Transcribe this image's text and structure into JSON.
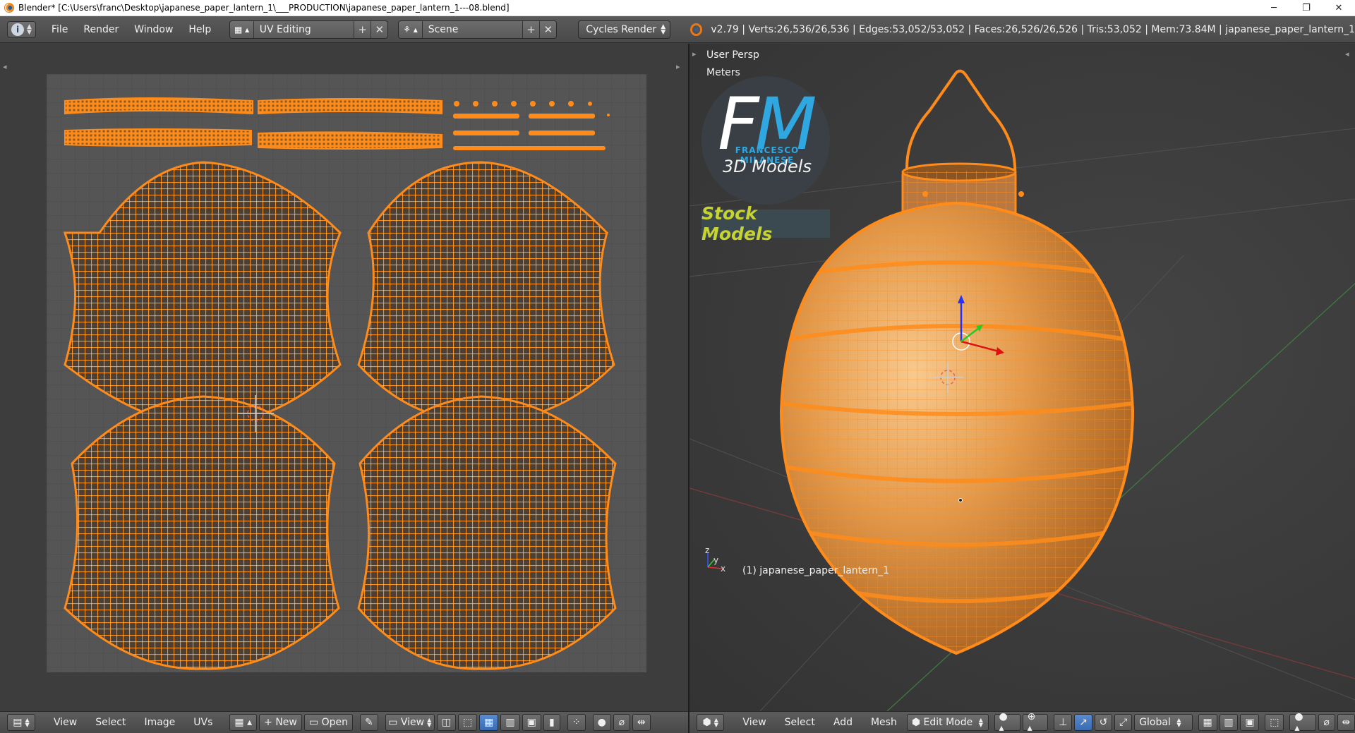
{
  "window": {
    "title": "Blender* [C:\\Users\\franc\\Desktop\\japanese_paper_lantern_1\\___PRODUCTION\\japanese_paper_lantern_1---08.blend]",
    "minimize": "─",
    "restore": "❐",
    "close": "✕"
  },
  "top_header": {
    "info_icon": "i",
    "menus": [
      "File",
      "Render",
      "Window",
      "Help"
    ],
    "screen_layout": "UV Editing",
    "scene": "Scene",
    "render_engine": "Cycles Render",
    "stats": "v2.79 | Verts:26,536/26,536 | Edges:53,052/53,052 | Faces:26,526/26,526 | Tris:53,052 | Mem:73.84M | japanese_paper_lantern_1"
  },
  "viewport": {
    "view_name": "User Persp",
    "units": "Meters",
    "object_label": "(1) japanese_paper_lantern_1",
    "axis_y": "y",
    "axis_x": "x",
    "axis_z": "z"
  },
  "logo": {
    "letter_f": "F",
    "letter_m": "M",
    "name": "FRANCESCO MILANESE",
    "line": "3D Models",
    "banner": "Stock Models"
  },
  "uv_header": {
    "menus": [
      "View",
      "Select",
      "Image",
      "UVs"
    ],
    "new_label": "New",
    "open_label": "Open",
    "view_label": "View"
  },
  "view3d_header": {
    "menus": [
      "View",
      "Select",
      "Add",
      "Mesh"
    ],
    "mode": "Edit Mode",
    "orientation": "Global"
  },
  "colors": {
    "accent_orange": "#ff8c1a",
    "uv_grid_bg": "#555555",
    "logo_blue": "#2fa7e0",
    "stock_yellow": "#c7d330"
  }
}
